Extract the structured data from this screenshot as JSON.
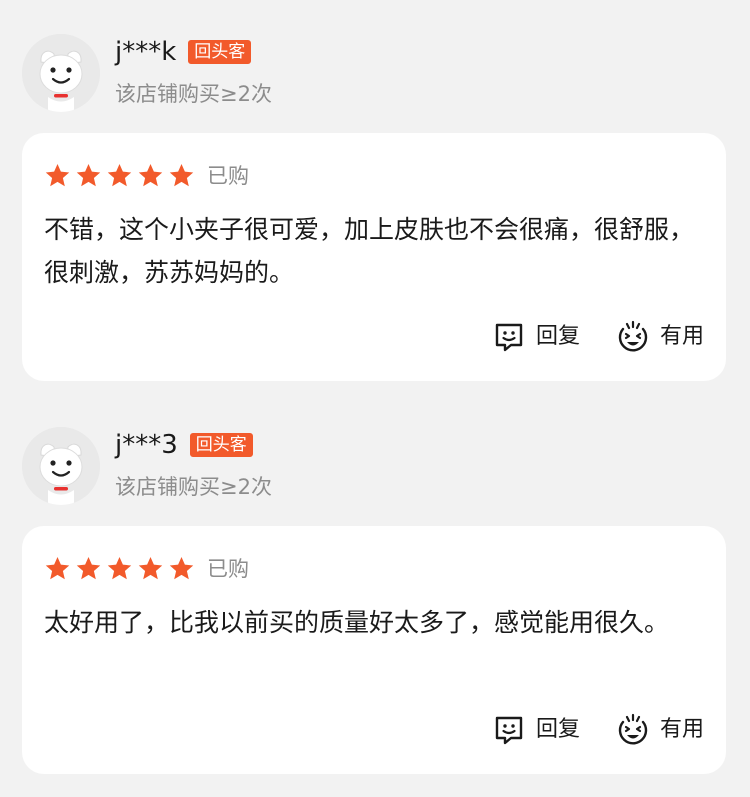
{
  "colors": {
    "star": "#f25a2b",
    "badge": "#f25a2b",
    "muted_text": "#8c8c8c",
    "background": "#f2f2f2",
    "card": "#ffffff"
  },
  "reviews": [
    {
      "username": "j***k",
      "badge": "回头客",
      "purchase_count": "该店铺购买≥2次",
      "rating": 5,
      "purchased_label": "已购",
      "text": "不错，这个小夹子很可爱，加上皮肤也不会很痛，很舒服，很刺激，苏苏妈妈的。",
      "reply_label": "回复",
      "useful_label": "有用"
    },
    {
      "username": "j***3",
      "badge": "回头客",
      "purchase_count": "该店铺购买≥2次",
      "rating": 5,
      "purchased_label": "已购",
      "text": "太好用了，比我以前买的质量好太多了，感觉能用很久。",
      "reply_label": "回复",
      "useful_label": "有用"
    }
  ],
  "icons": {
    "avatar": "dog-mascot-avatar",
    "rating": "star-icon",
    "reply": "smile-chat-icon",
    "useful": "happy-face-icon"
  }
}
